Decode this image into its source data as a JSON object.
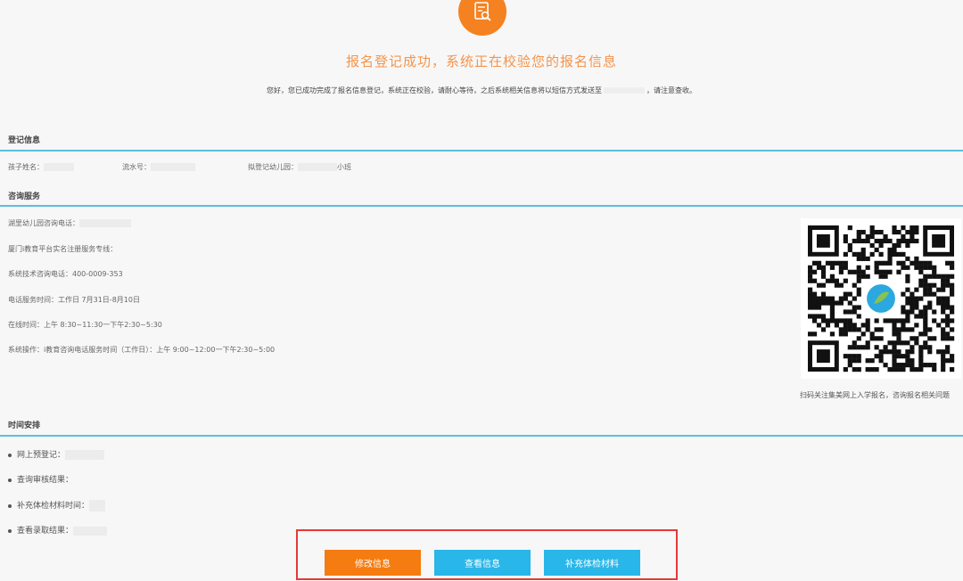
{
  "header": {
    "title": "报名登记成功，系统正在校验您的报名信息",
    "notice_before": "您好，您已成功完成了报名信息登记，系统正在校验，请耐心等待，之后系统相关信息将以短信方式发送至",
    "notice_after": "，请注意查收。"
  },
  "registration": {
    "section_title": "登记信息",
    "child_name_label": "孩子姓名：",
    "serial_label": "流水号：",
    "kindergarten_label": "拟登记幼儿园：",
    "kindergarten_suffix": "小班"
  },
  "consult": {
    "section_title": "咨询服务",
    "lines": [
      "湖里幼儿园咨询电话：",
      "厦门i教育平台实名注册服务专线：",
      "系统技术咨询电话：400-0009-353",
      "电话服务时间：工作日 7月31日-8月10日",
      "在线时间：上午 8:30~11:30一下午2:30~5:30",
      "系统操作：i教育咨询电话服务时间（工作日）：上午 9:00~12:00一下午2:30~5:00"
    ],
    "qr_caption": "扫码关注集美网上入学报名，咨询报名相关问题"
  },
  "schedule": {
    "section_title": "时间安排",
    "items": [
      "网上预登记：",
      "查询审核结果：",
      "补充体检材料时间：",
      "查看录取结果："
    ]
  },
  "actions": {
    "edit_label": "修改信息",
    "view_label": "查看信息",
    "supplement_label": "补充体检材料"
  },
  "colors": {
    "accent_orange": "#f57c10",
    "accent_blue": "#29b6e8",
    "rule_blue": "#5bc0de",
    "highlight_red": "#e53935"
  }
}
